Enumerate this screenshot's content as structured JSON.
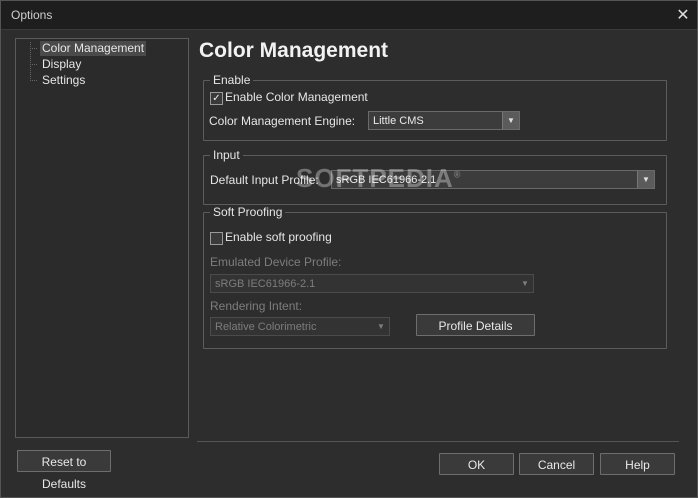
{
  "window": {
    "title": "Options"
  },
  "tree": {
    "items": [
      {
        "label": "Color Management"
      },
      {
        "label": "Display"
      },
      {
        "label": "Settings"
      }
    ]
  },
  "page": {
    "title": "Color Management"
  },
  "enable_group": {
    "legend": "Enable",
    "checkbox_label": "Enable Color Management",
    "engine_label": "Color Management Engine:",
    "engine_value": "Little CMS"
  },
  "input_group": {
    "legend": "Input",
    "profile_label": "Default Input Profile:",
    "profile_value": "sRGB IEC61966-2.1"
  },
  "soft_proofing": {
    "legend": "Soft Proofing",
    "checkbox_label": "Enable soft proofing",
    "device_label": "Emulated Device Profile:",
    "device_value": "sRGB IEC61966-2.1",
    "intent_label": "Rendering Intent:",
    "intent_value": "Relative Colorimetric",
    "details_button": "Profile Details"
  },
  "buttons": {
    "reset": "Reset to Defaults",
    "ok": "OK",
    "cancel": "Cancel",
    "help": "Help"
  },
  "watermark": {
    "text": "SOFTPEDIA",
    "mark": "®"
  },
  "colors": {
    "background": "#2d2d2d",
    "titlebar": "#1e1e1e",
    "text": "#e6e6e6",
    "disabled_text": "#7d7d7d"
  }
}
